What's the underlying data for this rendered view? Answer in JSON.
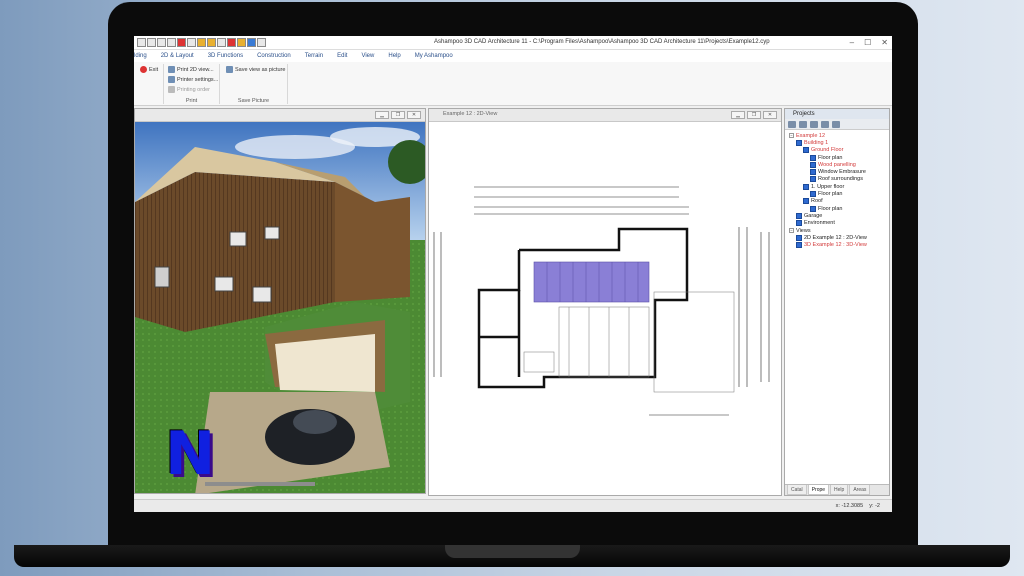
{
  "window": {
    "title": "Ashampoo 3D CAD Architecture 11 - C:\\Program Files\\Ashampoo\\Ashampoo 3D CAD Architecture 11\\Projects\\Example12.cyp"
  },
  "menu": [
    "lding",
    "2D & Layout",
    "3D Functions",
    "Construction",
    "Terrain",
    "Edit",
    "View",
    "Help",
    "My Ashampoo"
  ],
  "ribbon": {
    "exit": "Exit",
    "print_2d": "Print 2D view...",
    "printer_settings": "Printer settings...",
    "printing_order": "Printing order",
    "save_view": "Save view as picture",
    "group_print": "Print",
    "group_save": "Save Picture"
  },
  "pane2d": {
    "title": "Example 12 : 2D-View"
  },
  "projects": {
    "header": "Projects",
    "tree": [
      {
        "label": "Example 12",
        "level": 0,
        "red": true,
        "checkbox": false
      },
      {
        "label": "Building 1",
        "level": 1,
        "red": true,
        "checkbox": true
      },
      {
        "label": "Ground Floor",
        "level": 2,
        "red": true,
        "checkbox": true
      },
      {
        "label": "Floor plan",
        "level": 3,
        "red": false,
        "checkbox": true
      },
      {
        "label": "Wood panelling",
        "level": 3,
        "red": true,
        "checkbox": true
      },
      {
        "label": "Window Embrasure",
        "level": 3,
        "red": false,
        "checkbox": true
      },
      {
        "label": "Roof surroundings",
        "level": 3,
        "red": false,
        "checkbox": true
      },
      {
        "label": "1. Upper floor",
        "level": 2,
        "red": false,
        "checkbox": true
      },
      {
        "label": "Floor plan",
        "level": 3,
        "red": false,
        "checkbox": true
      },
      {
        "label": "Roof",
        "level": 2,
        "red": false,
        "checkbox": true
      },
      {
        "label": "Floor plan",
        "level": 3,
        "red": false,
        "checkbox": true
      },
      {
        "label": "Garage",
        "level": 1,
        "red": false,
        "checkbox": true
      },
      {
        "label": "Environment",
        "level": 1,
        "red": false,
        "checkbox": true
      },
      {
        "label": "Views",
        "level": 0,
        "red": false,
        "checkbox": false
      },
      {
        "label": "2D Example 12 : 2D-View",
        "level": 1,
        "red": false,
        "checkbox": true
      },
      {
        "label": "3D Example 12 : 3D-View",
        "level": 1,
        "red": true,
        "checkbox": true
      }
    ],
    "tabs": [
      "Catal",
      "Prope",
      "Help",
      "Areas"
    ]
  },
  "status": {
    "coords": "x: -12.3085",
    "y": "y: -2"
  },
  "logo": {
    "letter": "N"
  },
  "colors": {
    "accent": "#2f6ad0",
    "selected_text": "#d23a3a"
  }
}
